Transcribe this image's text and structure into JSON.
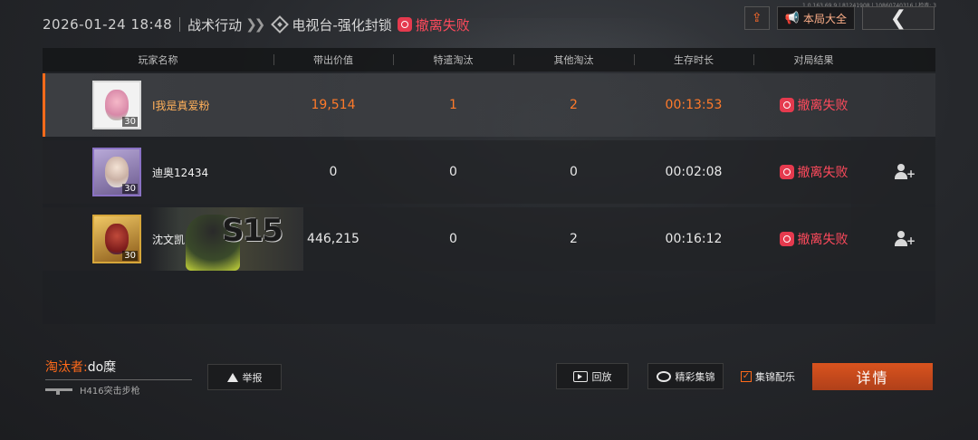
{
  "header": {
    "datetime": "2026-01-24 18:48",
    "mode": "战术行动",
    "chevrons": "❯❯",
    "map": "电视台-强化封锁",
    "result": "撤离失败",
    "version": "1.0.163.69.9 | 81241908 | 10860740316 | 检查: 3"
  },
  "toolbar": {
    "share_icon": "share-icon",
    "total_label": "本局大全",
    "total_icon": "megaphone-icon",
    "back_label": "❮"
  },
  "table": {
    "columns": [
      "玩家名称",
      "带出价值",
      "特遣淘汰",
      "其他淘汰",
      "生存时长",
      "对局结果"
    ],
    "rows": [
      {
        "name": "I我是真爱粉",
        "level": "30",
        "value": "19,514",
        "special_kills": "1",
        "other_kills": "2",
        "survival": "00:13:53",
        "result": "撤离失败",
        "is_self": true
      },
      {
        "name": "迪奥12434",
        "level": "30",
        "value": "0",
        "special_kills": "0",
        "other_kills": "0",
        "survival": "00:02:08",
        "result": "撤离失败",
        "is_self": false
      },
      {
        "name": "沈文凯",
        "level": "30",
        "value": "446,215",
        "special_kills": "0",
        "other_kills": "2",
        "survival": "00:16:12",
        "result": "撤离失败",
        "is_self": false,
        "banner": "S15"
      }
    ]
  },
  "killer": {
    "label": "淘汰者:",
    "name": "do糜",
    "weapon": "H416突击步枪"
  },
  "actions": {
    "report": "举报",
    "replay": "回放",
    "highlight": "精彩集锦",
    "bgm": "集锦配乐",
    "bgm_checked": true,
    "detail": "详情"
  },
  "colors": {
    "accent": "#ff6a1a",
    "fail": "#ff4a5c",
    "detail_button": "#c8481c"
  }
}
